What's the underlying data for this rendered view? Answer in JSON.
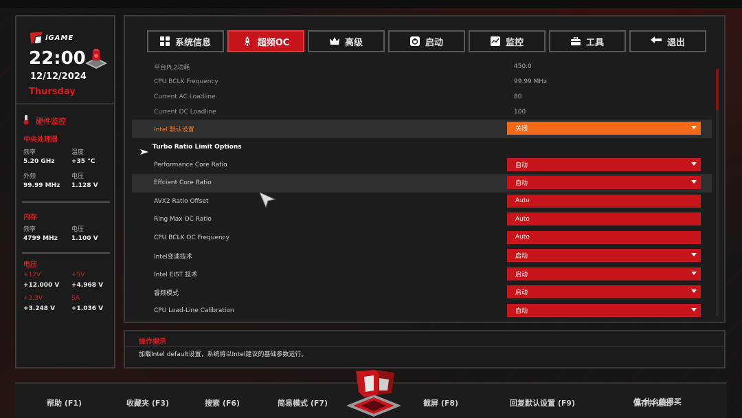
{
  "brand": {
    "logo_text": "iGAME"
  },
  "clock": {
    "time": "22:00",
    "date": "12/12/2024",
    "day": "Thursday"
  },
  "hardware": {
    "title": "硬件监控",
    "cpu": {
      "title": "中央处理器",
      "freq_label": "频率",
      "freq_value": "5.20 GHz",
      "temp_label": "温度",
      "temp_value": "+35 °C",
      "ext_label": "外频",
      "ext_value": "99.99 MHz",
      "volt_label": "电压",
      "volt_value": "1.128 V"
    },
    "memory": {
      "title": "内存",
      "freq_label": "频率",
      "freq_value": "4799 MHz",
      "volt_label": "电压",
      "volt_value": "1.100 V"
    },
    "voltage": {
      "title": "电压",
      "v12_label": "+12V",
      "v12_value": "+12.000 V",
      "v5_label": "+5V",
      "v5_value": "+4.968 V",
      "v33_label": "+3.3V",
      "v33_value": "+3.248 V",
      "sa_label": "SA",
      "sa_value": "+1.036 V"
    }
  },
  "tabs": [
    {
      "label": "系统信息",
      "icon": "grid-icon"
    },
    {
      "label": "超频OC",
      "icon": "rocket-icon",
      "active": true
    },
    {
      "label": "高级",
      "icon": "crown-icon"
    },
    {
      "label": "启动",
      "icon": "power-icon"
    },
    {
      "label": "监控",
      "icon": "monitor-icon"
    },
    {
      "label": "工具",
      "icon": "toolbox-icon"
    },
    {
      "label": "退出",
      "icon": "back-arrow-icon"
    }
  ],
  "settings": {
    "pl2_label": "平台PL2功耗",
    "pl2_value": "450.0",
    "bclk_label": "CPU BCLK Frequency",
    "bclk_value": "99.99 MHz",
    "ac_label": "Current AC Loadline",
    "ac_value": "80",
    "dc_label": "Current DC Loadline",
    "dc_value": "100",
    "intel_default_label": "Intel 默认设置",
    "intel_default_value": "关闭",
    "turbo_label": "Turbo Ratio Limit Options",
    "pcore_label": "Performance Core Ratio",
    "pcore_value": "自动",
    "ecore_label": "Effcient Core Ratio",
    "ecore_value": "自动",
    "avx2_label": "AVX2 Ratio Offset",
    "avx2_value": "Auto",
    "ring_label": "Ring Max OC Ratio",
    "ring_value": "Auto",
    "bclk_oc_label": "CPU BCLK OC Frequency",
    "bclk_oc_value": "Auto",
    "speedstep_label": "Intel变速技术",
    "speedstep_value": "启动",
    "eist_label": "Intel EIST 技术",
    "eist_value": "启动",
    "turbo_mode_label": "睿频模式",
    "turbo_mode_value": "启动",
    "llc_label": "CPU Load-Line Calibration",
    "llc_value": "自动"
  },
  "help": {
    "title": "操作提示",
    "text": "加载Intel default设置，系统将以Intel建议的基础参数运行。"
  },
  "footer": {
    "help": "帮助 (F1)",
    "favorites": "收藏夹 (F3)",
    "search": "搜索 (F6)",
    "easy_mode": "简易模式 (F7)",
    "screenshot": "截屏 (F8)",
    "defaults": "回复默认设置 (F9)",
    "save_exit": "保存并退出",
    "watermark": "值 什么值得买"
  },
  "colors": {
    "accent": "#c8141b",
    "orange": "#f26a18",
    "bg": "#151515"
  }
}
